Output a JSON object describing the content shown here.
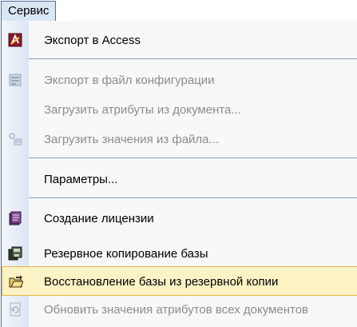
{
  "menu": {
    "title": "Сервис",
    "items": [
      {
        "label": "Экспорт в Access",
        "icon": "access-icon",
        "enabled": true
      },
      {
        "label": "Экспорт в файл конфигурации",
        "icon": "config-export-icon",
        "enabled": false
      },
      {
        "label": "Загрузить атрибуты из документа...",
        "icon": "",
        "enabled": false
      },
      {
        "label": "Загрузить значения из файла...",
        "icon": "load-values-icon",
        "enabled": false
      },
      {
        "label": "Параметры...",
        "icon": "",
        "enabled": true
      },
      {
        "label": "Создание лицензии",
        "icon": "license-icon",
        "enabled": true
      },
      {
        "label": "Резервное копирование базы",
        "icon": "backup-icon",
        "enabled": true
      },
      {
        "label": "Восстановление базы из резервной копии",
        "icon": "restore-folder-icon",
        "enabled": true,
        "selected": true
      },
      {
        "label": "Обновить значения атрибутов всех документов",
        "icon": "refresh-document-icon",
        "enabled": false
      }
    ]
  },
  "colors": {
    "highlight": "#fdf3c5",
    "highlight_border": "#e3b84b",
    "menu_border": "#4b6b9d",
    "disabled_text": "#8c8c8c"
  }
}
